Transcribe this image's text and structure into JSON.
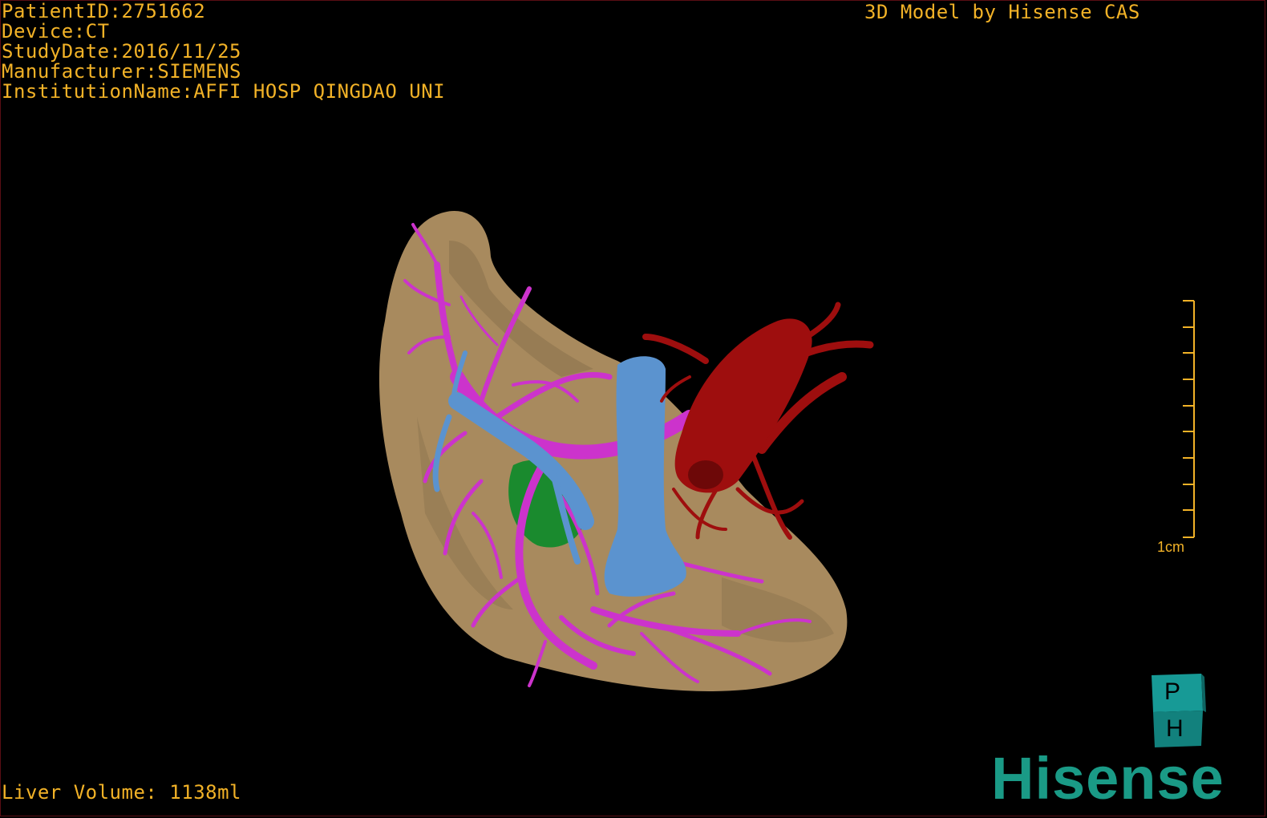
{
  "overlay": {
    "patient_id": "PatientID:2751662",
    "device": "Device:CT",
    "study_date": "StudyDate:2016/11/25",
    "manufacturer": "Manufacturer:SIEMENS",
    "institution": "InstitutionName:AFFI HOSP QINGDAO UNI",
    "brand": "3D Model by Hisense CAS",
    "liver_volume": "Liver Volume: 1138ml"
  },
  "scale": {
    "label": "1cm"
  },
  "orientation_cube": {
    "top_letter": "P",
    "bottom_letter": "H"
  },
  "logo": {
    "text": "Hisense"
  },
  "colors": {
    "overlay_text": "#f2b227",
    "liver": "#a88a5e",
    "portal_vein": "#cc33cc",
    "hepatic_vein": "#5b93cf",
    "artery": "#9e0e0e",
    "lesion": "#1a8a2e",
    "logo": "#1a9a86"
  },
  "icons": [
    "liver-model",
    "scale-bar-icon",
    "orientation-cube-icon",
    "hisense-logo"
  ]
}
